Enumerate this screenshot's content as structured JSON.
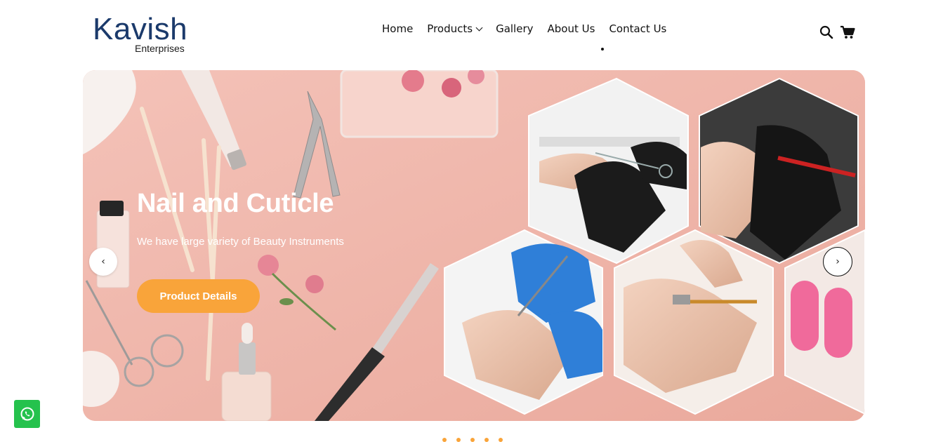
{
  "brand": {
    "name": "Kavish",
    "tagline": "Enterprises",
    "color": "#1b3a6b"
  },
  "nav": {
    "items": [
      {
        "label": "Home"
      },
      {
        "label": "Products",
        "has_dropdown": true
      },
      {
        "label": "Gallery"
      },
      {
        "label": "About Us"
      },
      {
        "label": "Contact Us"
      }
    ]
  },
  "header_icons": {
    "search": "search-icon",
    "cart": "cart-icon"
  },
  "hero": {
    "title": "Nail and Cuticle",
    "subtitle": "We have large variety of Beauty Instruments",
    "cta_label": "Product Details",
    "prev_label": "‹",
    "next_label": "›",
    "background_color": "#f0b9ad",
    "accent_color": "#f9a43a"
  },
  "carousel": {
    "slide_count": 5
  },
  "whatsapp": {
    "icon": "whatsapp-icon",
    "color": "#25c24d"
  }
}
